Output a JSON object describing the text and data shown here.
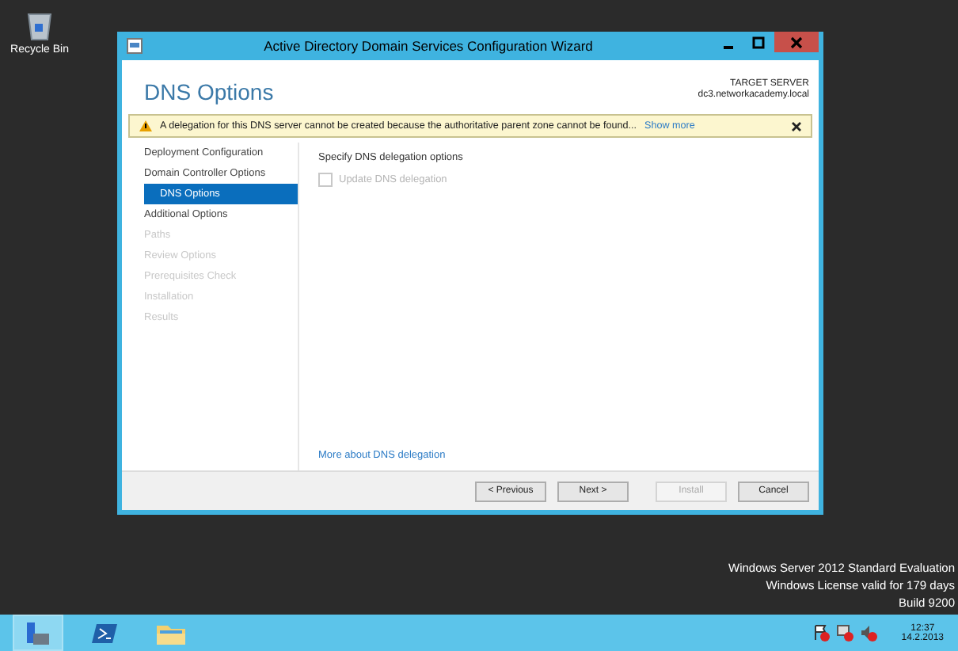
{
  "desktop": {
    "icons": [
      {
        "label": "Recycle Bin"
      }
    ],
    "edition": [
      "Windows Server 2012 Standard Evaluation",
      "Windows License valid for 179 days",
      "Build 9200"
    ]
  },
  "window": {
    "title": "Active Directory Domain Services Configuration Wizard"
  },
  "header": {
    "title": "DNS Options",
    "target_label": "TARGET SERVER",
    "target_value": "dc3.networkacademy.local"
  },
  "warning": {
    "text": "A delegation for this DNS server cannot be created because the authoritative parent zone cannot be found...",
    "link": "Show more"
  },
  "nav": [
    {
      "label": "Deployment Configuration",
      "selected": false,
      "disabled": false,
      "indent": false
    },
    {
      "label": "Domain Controller Options",
      "selected": false,
      "disabled": false,
      "indent": false
    },
    {
      "label": "DNS Options",
      "selected": true,
      "disabled": false,
      "indent": true
    },
    {
      "label": "Additional Options",
      "selected": false,
      "disabled": false,
      "indent": false
    },
    {
      "label": "Paths",
      "selected": false,
      "disabled": true,
      "indent": false
    },
    {
      "label": "Review Options",
      "selected": false,
      "disabled": true,
      "indent": false
    },
    {
      "label": "Prerequisites Check",
      "selected": false,
      "disabled": true,
      "indent": false
    },
    {
      "label": "Installation",
      "selected": false,
      "disabled": true,
      "indent": false
    },
    {
      "label": "Results",
      "selected": false,
      "disabled": true,
      "indent": false
    }
  ],
  "content": {
    "heading": "Specify DNS delegation options",
    "checkbox": {
      "label": "Update DNS delegation",
      "checked": false,
      "disabled": true
    },
    "link": "More about DNS delegation"
  },
  "buttons": [
    {
      "label": "< Previous",
      "disabled": false
    },
    {
      "label": "Next >",
      "disabled": false
    },
    {
      "label": "Install",
      "disabled": true
    },
    {
      "label": "Cancel",
      "disabled": false
    }
  ],
  "taskbar": {
    "time": "12:37",
    "date": "14.2.2013"
  }
}
